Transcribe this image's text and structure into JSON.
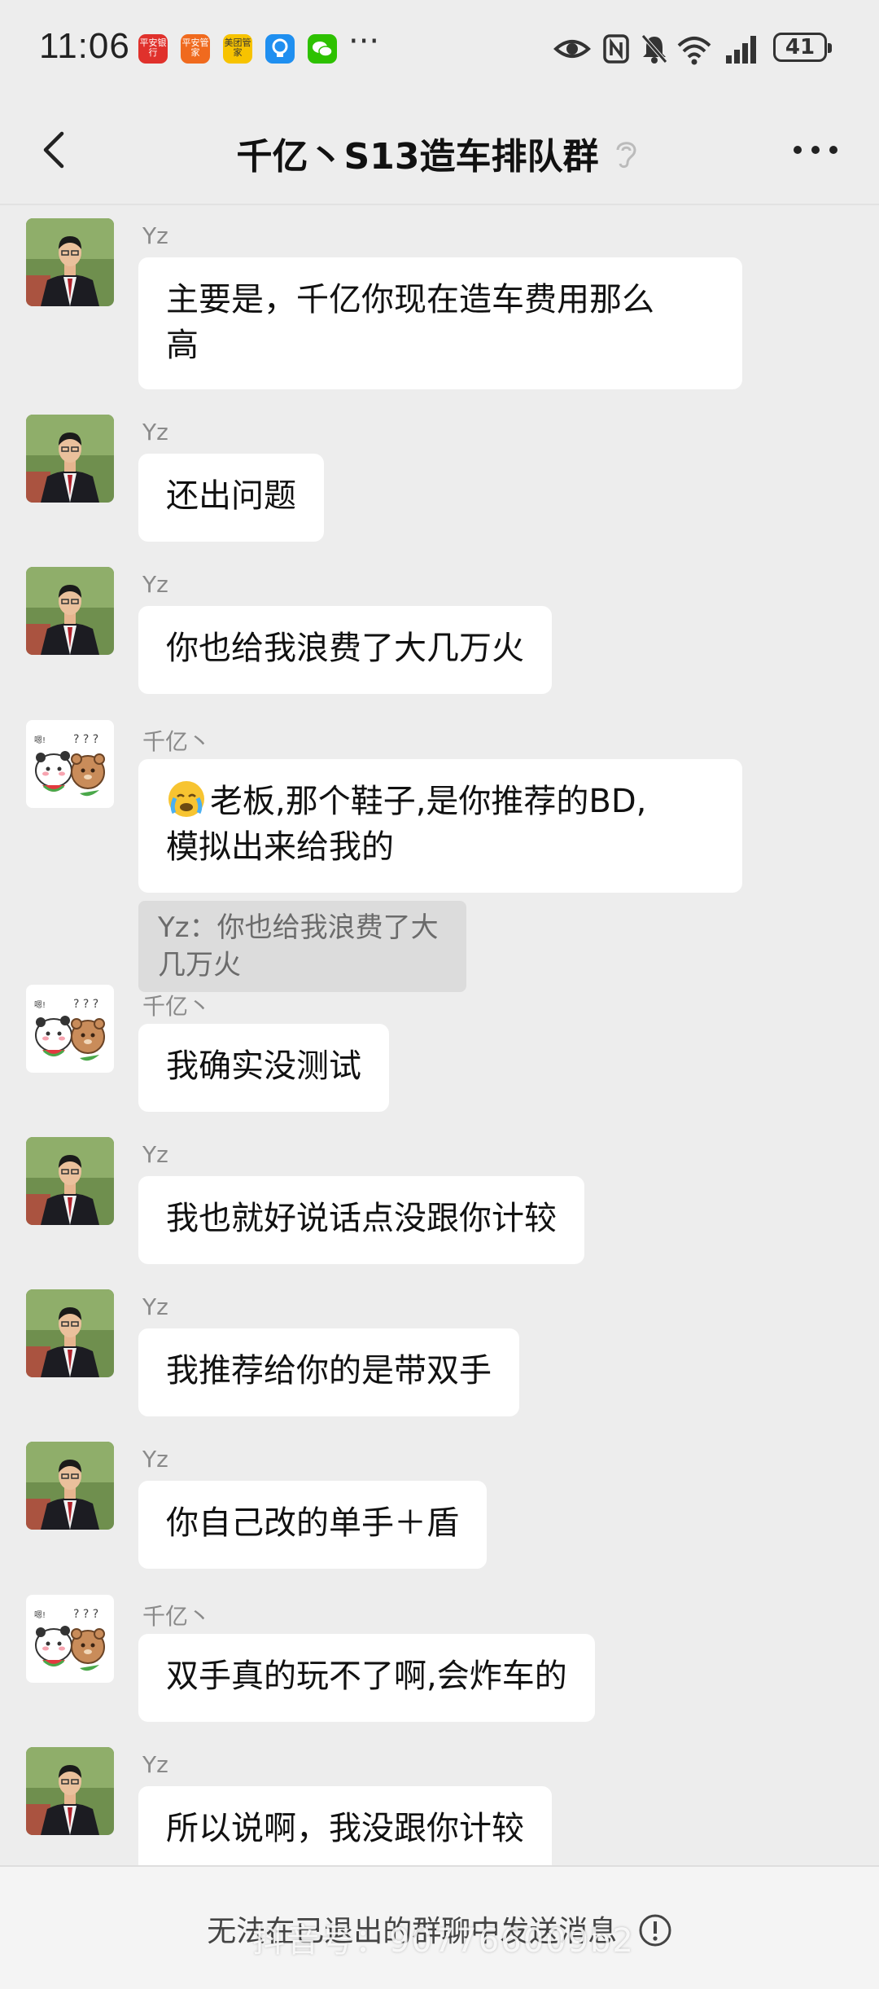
{
  "status_bar": {
    "time": "11:06",
    "app_icons": [
      {
        "name": "pingan-bank-icon",
        "label": "平安银行",
        "color": "#e0312c"
      },
      {
        "name": "pingan-guanjia-icon",
        "label": "平安管家",
        "color": "#f06a1e"
      },
      {
        "name": "meituan-icon",
        "label": "美团管家",
        "color": "#f7c300"
      },
      {
        "name": "bulb-app-icon",
        "label": "",
        "color": "#1f8ff0"
      },
      {
        "name": "wechat-icon",
        "label": "",
        "color": "#2dc100"
      }
    ],
    "more_glyph": "···",
    "battery": "41"
  },
  "header": {
    "title": "千亿丶S13造车排队群"
  },
  "messages": [
    {
      "sender": "Yz",
      "avatar": "man-suit-avatar",
      "text_lines": [
        "主要是，千亿你现在造车费用那么",
        "高"
      ]
    },
    {
      "sender": "Yz",
      "avatar": "man-suit-avatar",
      "text_lines": [
        "还出问题"
      ]
    },
    {
      "sender": "Yz",
      "avatar": "man-suit-avatar",
      "text_lines": [
        "你也给我浪费了大几万火"
      ]
    },
    {
      "sender": "千亿丶",
      "avatar": "bears-avatar",
      "emoji": "crying-face-emoji",
      "text_lines": [
        "老板,那个鞋子,是你推荐的BD,",
        "模拟出来给我的"
      ],
      "quote": "Yz：你也给我浪费了大几万火"
    },
    {
      "sender": "千亿丶",
      "avatar": "bears-avatar",
      "text_lines": [
        "我确实没测试"
      ]
    },
    {
      "sender": "Yz",
      "avatar": "man-suit-avatar",
      "text_lines": [
        "我也就好说话点没跟你计较"
      ]
    },
    {
      "sender": "Yz",
      "avatar": "man-suit-avatar",
      "text_lines": [
        "我推荐给你的是带双手"
      ]
    },
    {
      "sender": "Yz",
      "avatar": "man-suit-avatar",
      "text_lines": [
        "你自己改的单手＋盾"
      ]
    },
    {
      "sender": "千亿丶",
      "avatar": "bears-avatar",
      "text_lines": [
        "双手真的玩不了啊,会炸车的"
      ]
    },
    {
      "sender": "Yz",
      "avatar": "man-suit-avatar",
      "text_lines": [
        "所以说啊，我没跟你计较"
      ]
    }
  ],
  "footer": {
    "notice": "无法在已退出的群聊中发送消息",
    "watermark": "抖音号：907766009b2"
  }
}
